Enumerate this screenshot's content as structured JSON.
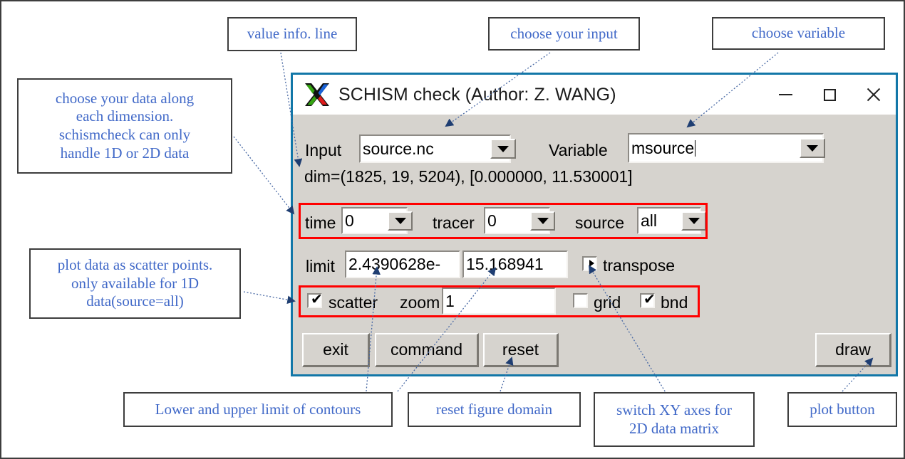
{
  "window": {
    "title": "SCHISM check (Author: Z. WANG)",
    "logo_icon": "x11-logo-icon",
    "minimize_label": "—",
    "maximize_label": "□",
    "close_label": "✕",
    "border_color": "#1277a8",
    "face_color": "#d6d3ce"
  },
  "form": {
    "input_label": "Input",
    "input_value": "source.nc",
    "variable_label": "Variable",
    "variable_value": "msource",
    "info_line": "dim=(1825, 19, 5204), [0.000000, 11.530001]",
    "time_label": "time",
    "time_value": "0",
    "tracer_label": "tracer",
    "tracer_value": "0",
    "source_label": "source",
    "source_value": "all",
    "limit_label": "limit",
    "limit_lower": "2.4390628e-",
    "limit_upper": "15.168941",
    "transpose_label": "transpose",
    "transpose_checked": false,
    "scatter_label": "scatter",
    "scatter_checked": true,
    "zoom_label": "zoom",
    "zoom_value": "1",
    "grid_label": "grid",
    "grid_checked": false,
    "bnd_label": "bnd",
    "bnd_checked": true
  },
  "buttons": {
    "exit": "exit",
    "command": "command",
    "reset": "reset",
    "draw": "draw"
  },
  "highlight_color": "#ff0000",
  "annotations": {
    "text_color": "#4169c8",
    "items": [
      {
        "id": "value-info-line",
        "text": "value info. line"
      },
      {
        "id": "choose-your-input",
        "text": "choose your input"
      },
      {
        "id": "choose-variable",
        "text": "choose variable"
      },
      {
        "id": "choose-data-dims",
        "text": "choose your data along\neach dimension.\nschismcheck can only\nhandle 1D or 2D data"
      },
      {
        "id": "scatter-note",
        "text": "plot data as scatter points.\nonly available for 1D\ndata(source=all)"
      },
      {
        "id": "contour-limits",
        "text": "Lower and upper limit of contours"
      },
      {
        "id": "reset-domain",
        "text": "reset figure domain"
      },
      {
        "id": "switch-xy",
        "text": "switch XY axes for\n2D data matrix"
      },
      {
        "id": "plot-button-note",
        "text": "plot button"
      }
    ]
  }
}
